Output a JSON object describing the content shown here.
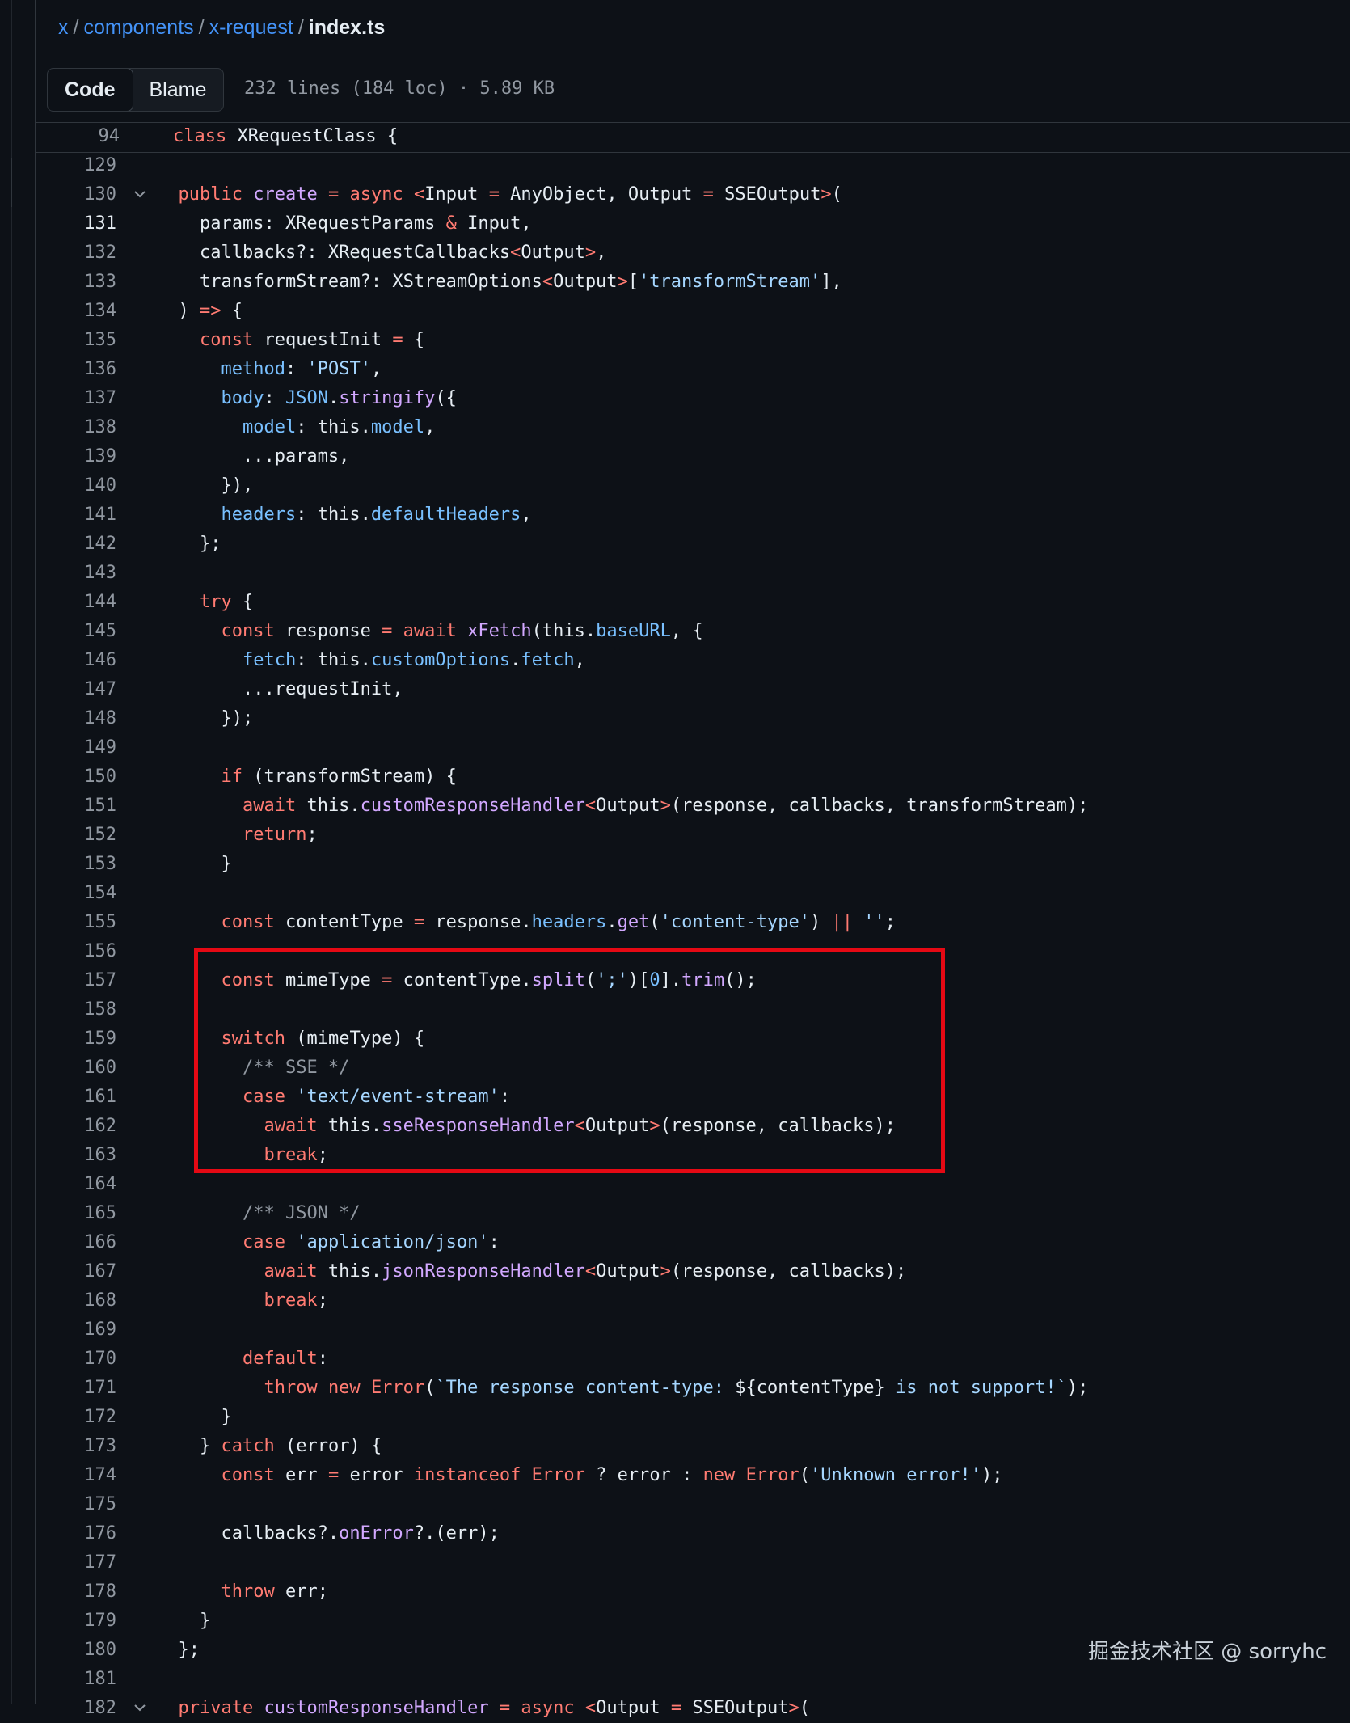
{
  "breadcrumb": {
    "root": "x",
    "dir1": "components",
    "dir2": "x-request",
    "file": "index.ts",
    "separator": "/"
  },
  "toolbar": {
    "code_tab": "Code",
    "blame_tab": "Blame",
    "file_info": "232 lines (184 loc) · 5.89 KB"
  },
  "sticky": {
    "line": "94",
    "code": "class XRequestClass {"
  },
  "lines": [
    {
      "n": "129",
      "html": ""
    },
    {
      "n": "130",
      "html": "  <span class=\"k\">public</span> <span class=\"fn\">create</span> <span class=\"k\">=</span> <span class=\"k\">async</span> <span class=\"k\">&lt;</span>Input <span class=\"k\">=</span> AnyObject, Output <span class=\"k\">=</span> SSEOutput<span class=\"k\">&gt;</span>(",
      "fold": true
    },
    {
      "n": "131",
      "html": "    params: XRequestParams <span class=\"k\">&amp;</span> Input,",
      "cur": true
    },
    {
      "n": "132",
      "html": "    callbacks?: XRequestCallbacks<span class=\"k\">&lt;</span>Output<span class=\"k\">&gt;</span>,"
    },
    {
      "n": "133",
      "html": "    transformStream?: XStreamOptions<span class=\"k\">&lt;</span>Output<span class=\"k\">&gt;</span>[<span class=\"s\">'transformStream'</span>],"
    },
    {
      "n": "134",
      "html": "  ) <span class=\"k\">=&gt;</span> {"
    },
    {
      "n": "135",
      "html": "    <span class=\"k\">const</span> requestInit <span class=\"k\">=</span> {"
    },
    {
      "n": "136",
      "html": "      <span class=\"p\">method</span>: <span class=\"s\">'POST'</span>,"
    },
    {
      "n": "137",
      "html": "      <span class=\"p\">body</span>: <span class=\"f\">JSON</span>.<span class=\"fn\">stringify</span>({"
    },
    {
      "n": "138",
      "html": "        <span class=\"p\">model</span>: this.<span class=\"p\">model</span>,"
    },
    {
      "n": "139",
      "html": "        ...params,"
    },
    {
      "n": "140",
      "html": "      }),"
    },
    {
      "n": "141",
      "html": "      <span class=\"p\">headers</span>: this.<span class=\"p\">defaultHeaders</span>,"
    },
    {
      "n": "142",
      "html": "    };"
    },
    {
      "n": "143",
      "html": ""
    },
    {
      "n": "144",
      "html": "    <span class=\"k\">try</span> {"
    },
    {
      "n": "145",
      "html": "      <span class=\"k\">const</span> response <span class=\"k\">=</span> <span class=\"k\">await</span> <span class=\"fn\">xFetch</span>(this.<span class=\"p\">baseURL</span>, {"
    },
    {
      "n": "146",
      "html": "        <span class=\"p\">fetch</span>: this.<span class=\"p\">customOptions</span>.<span class=\"p\">fetch</span>,"
    },
    {
      "n": "147",
      "html": "        ...requestInit,"
    },
    {
      "n": "148",
      "html": "      });"
    },
    {
      "n": "149",
      "html": ""
    },
    {
      "n": "150",
      "html": "      <span class=\"k\">if</span> (transformStream) {"
    },
    {
      "n": "151",
      "html": "        <span class=\"k\">await</span> this.<span class=\"fn\">customResponseHandler</span><span class=\"k\">&lt;</span>Output<span class=\"k\">&gt;</span>(response, callbacks, transformStream);"
    },
    {
      "n": "152",
      "html": "        <span class=\"k\">return</span>;"
    },
    {
      "n": "153",
      "html": "      }"
    },
    {
      "n": "154",
      "html": ""
    },
    {
      "n": "155",
      "html": "      <span class=\"k\">const</span> contentType <span class=\"k\">=</span> response.<span class=\"p\">headers</span>.<span class=\"fn\">get</span>(<span class=\"s\">'content-type'</span>) <span class=\"k\">||</span> <span class=\"s\">''</span>;"
    },
    {
      "n": "156",
      "html": ""
    },
    {
      "n": "157",
      "html": "      <span class=\"k\">const</span> mimeType <span class=\"k\">=</span> contentType.<span class=\"fn\">split</span>(<span class=\"s\">';'</span>)[<span class=\"f\">0</span>].<span class=\"fn\">trim</span>();"
    },
    {
      "n": "158",
      "html": ""
    },
    {
      "n": "159",
      "html": "      <span class=\"k\">switch</span> (mimeType) {"
    },
    {
      "n": "160",
      "html": "        <span class=\"c\">/** SSE */</span>"
    },
    {
      "n": "161",
      "html": "        <span class=\"k\">case</span> <span class=\"s\">'text/event-stream'</span>:"
    },
    {
      "n": "162",
      "html": "          <span class=\"k\">await</span> this.<span class=\"fn\">sseResponseHandler</span><span class=\"k\">&lt;</span>Output<span class=\"k\">&gt;</span>(response, callbacks);"
    },
    {
      "n": "163",
      "html": "          <span class=\"k\">break</span>;"
    },
    {
      "n": "164",
      "html": ""
    },
    {
      "n": "165",
      "html": "        <span class=\"c\">/** JSON */</span>"
    },
    {
      "n": "166",
      "html": "        <span class=\"k\">case</span> <span class=\"s\">'application/json'</span>:"
    },
    {
      "n": "167",
      "html": "          <span class=\"k\">await</span> this.<span class=\"fn\">jsonResponseHandler</span><span class=\"k\">&lt;</span>Output<span class=\"k\">&gt;</span>(response, callbacks);"
    },
    {
      "n": "168",
      "html": "          <span class=\"k\">break</span>;"
    },
    {
      "n": "169",
      "html": ""
    },
    {
      "n": "170",
      "html": "        <span class=\"k\">default</span>:"
    },
    {
      "n": "171",
      "html": "          <span class=\"k\">throw</span> <span class=\"k\">new</span> <span class=\"k\">Error</span>(<span class=\"s\">`The response content-type: </span>${contentType}<span class=\"s\"> is not support!`</span>);"
    },
    {
      "n": "172",
      "html": "      }"
    },
    {
      "n": "173",
      "html": "    } <span class=\"k\">catch</span> (error) {"
    },
    {
      "n": "174",
      "html": "      <span class=\"k\">const</span> err <span class=\"k\">=</span> error <span class=\"k\">instanceof</span> <span class=\"k\">Error</span> ? error : <span class=\"k\">new</span> <span class=\"k\">Error</span>(<span class=\"s\">'Unknown error!'</span>);"
    },
    {
      "n": "175",
      "html": ""
    },
    {
      "n": "176",
      "html": "      callbacks?.<span class=\"fn\">onError</span>?.(err);"
    },
    {
      "n": "177",
      "html": ""
    },
    {
      "n": "178",
      "html": "      <span class=\"k\">throw</span> err;"
    },
    {
      "n": "179",
      "html": "    }"
    },
    {
      "n": "180",
      "html": "  };"
    },
    {
      "n": "181",
      "html": ""
    },
    {
      "n": "182",
      "html": "  <span class=\"k\">private</span> <span class=\"fn\">customResponseHandler</span> <span class=\"k\">=</span> <span class=\"k\">async</span> <span class=\"k\">&lt;</span>Output <span class=\"k\">=</span> SSEOutput<span class=\"k\">&gt;</span>(",
      "fold": true
    }
  ],
  "watermark": "掘金技术社区 @ sorryhc",
  "colors": {
    "background": "#0d1117",
    "keyword": "#ff7b72",
    "property": "#79c0ff",
    "string": "#a5d6ff",
    "function": "#d2a8ff",
    "highlight_box": "#e50914"
  }
}
